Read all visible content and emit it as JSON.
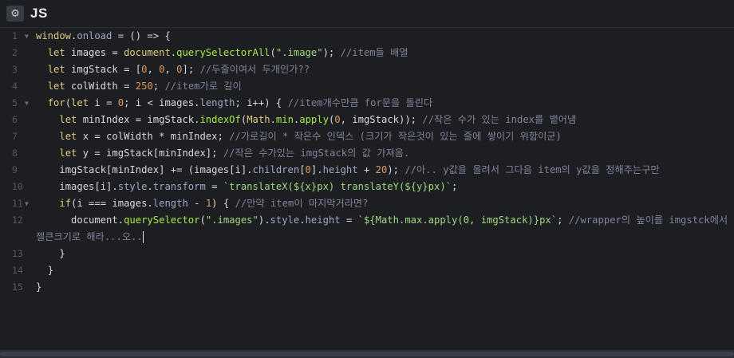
{
  "panel": {
    "icon": "gear-icon",
    "title": "JS"
  },
  "code": {
    "l1": {
      "n": "1",
      "a": "window",
      "b": ".",
      "c": "onload",
      "d": " = () => {"
    },
    "l2": {
      "n": "2",
      "kw": "let",
      "a": " images = ",
      "b": "document",
      "c": ".",
      "d": "querySelectorAll",
      "e": "(",
      "f": "\".image\"",
      "g": "); ",
      "cmt": "//item들 배열"
    },
    "l3": {
      "n": "3",
      "kw": "let",
      "a": " imgStack = [",
      "n1": "0",
      "s1": ", ",
      "n2": "0",
      "s2": ", ",
      "n3": "0",
      "b": "]; ",
      "cmt": "//두줄이여서 두개인가??"
    },
    "l4": {
      "n": "4",
      "kw": "let",
      "a": " colWidth = ",
      "n1": "250",
      "b": "; ",
      "cmt": "//item가로 길이"
    },
    "l5": {
      "n": "5",
      "kw": "for",
      "a": "(",
      "kw2": "let",
      "b": " i = ",
      "n1": "0",
      "c": "; i < images.",
      "d": "length",
      "e": "; i++) { ",
      "cmt": "//item개수만큼 for문을 돌린다"
    },
    "l6": {
      "n": "6",
      "kw": "let",
      "a": " minIndex = imgStack.",
      "fn": "indexOf",
      "b": "(",
      "c": "Math",
      "d": ".",
      "fn2": "min",
      "e": ".",
      "fn3": "apply",
      "f": "(",
      "n1": "0",
      "g": ", imgStack)); ",
      "cmt": "//작은 수가 있는 index를 뱉어냄"
    },
    "l7": {
      "n": "7",
      "kw": "let",
      "a": " x = colWidth * minIndex; ",
      "cmt": "//가로길이 * 작은수 인덱스 (크기가 작은것이 있는 줄에 쌓이기 위함이군)"
    },
    "l8": {
      "n": "8",
      "kw": "let",
      "a": " y = imgStack[minIndex]; ",
      "cmt": "//작은 수가있는 imgStack의 값 가져옴."
    },
    "l9": {
      "n": "9",
      "a": "imgStack[minIndex] += (images[i].",
      "p1": "children",
      "b": "[",
      "n1": "0",
      "c": "].",
      "p2": "height",
      "d": " + ",
      "n2": "20",
      "e": "); ",
      "cmt": "//아.. y값을 올려서 그다음 item의 y값을 정해주는구만"
    },
    "l10": {
      "n": "10",
      "a": "images[i].",
      "p1": "style",
      "b": ".",
      "p2": "transform",
      "c": " = ",
      "str": "`translateX(${x}px) translateY(${y}px)`",
      "d": ";"
    },
    "l11": {
      "n": "11",
      "kw": "if",
      "a": "(i === images.",
      "p1": "length",
      "b": " - ",
      "n1": "1",
      "c": ") { ",
      "cmt": "//만약 item이 마지막거라면?"
    },
    "l12": {
      "n": "12",
      "a": "document",
      "b": ".",
      "fn": "querySelector",
      "c": "(",
      "str": "\".images\"",
      "d": ").",
      "p1": "style",
      "e": ".",
      "p2": "height",
      "f": " = ",
      "str2": "`${Math.max.apply(0, imgStack)}px`",
      "g": "; ",
      "cmt": "//wrapper의 높이를 imgstck에서 젤큰크기로 해라...오.."
    },
    "l13": {
      "n": "13",
      "a": "}"
    },
    "l14": {
      "n": "14",
      "a": "}"
    },
    "l15": {
      "n": "15",
      "a": "}"
    }
  }
}
